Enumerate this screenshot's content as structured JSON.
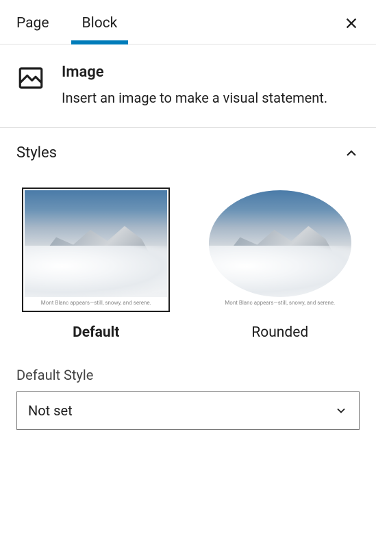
{
  "tabs": {
    "page": "Page",
    "block": "Block"
  },
  "block": {
    "title": "Image",
    "description": "Insert an image to make a visual statement."
  },
  "styles_panel": {
    "title": "Styles",
    "preview_caption": "Mont Blanc appears—still, snowy, and serene.",
    "options": {
      "default": "Default",
      "rounded": "Rounded"
    },
    "default_style_label": "Default Style",
    "default_style_value": "Not set"
  }
}
